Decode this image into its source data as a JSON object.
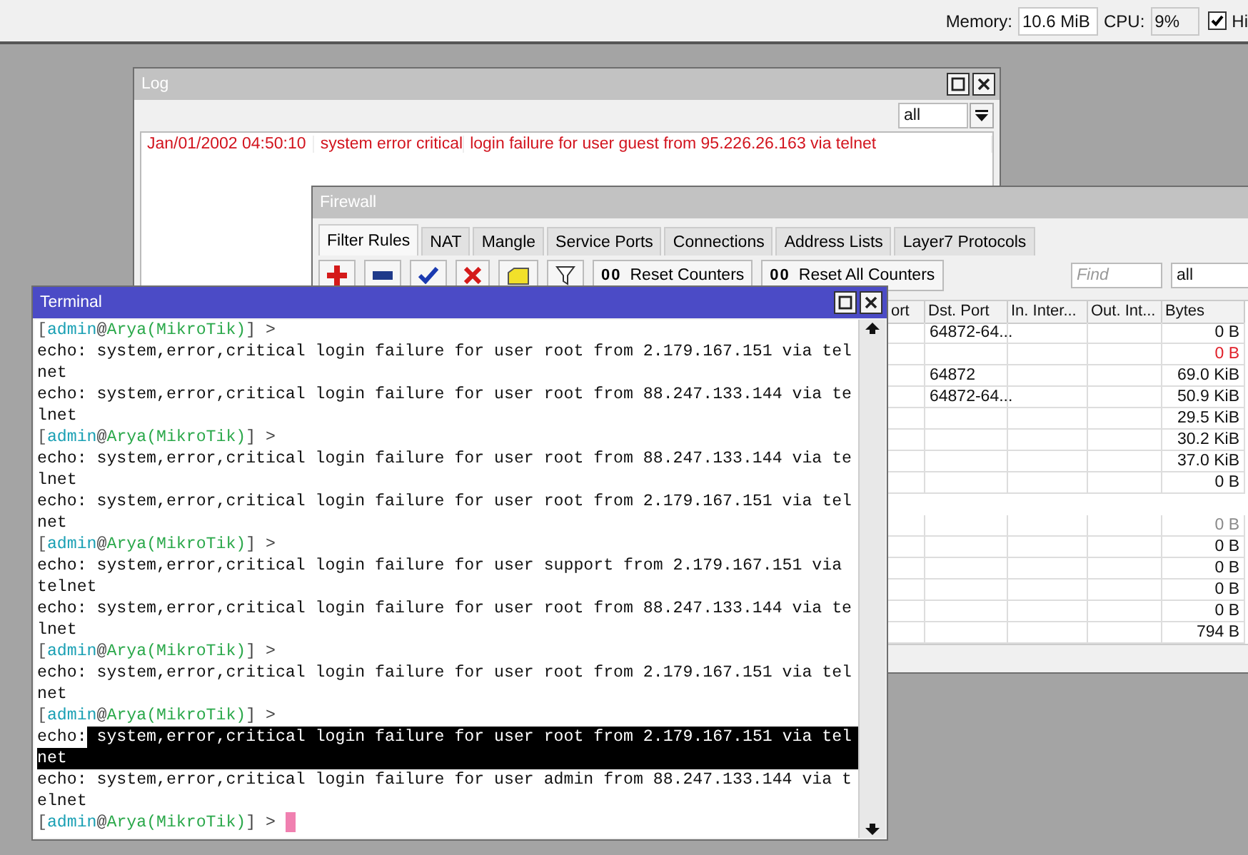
{
  "top_bar": {
    "memory_label": "Memory:",
    "memory_value": "10.6 MiB",
    "cpu_label": "CPU:",
    "cpu_value": "9%",
    "hide_checked": true,
    "hide_label": "Hi"
  },
  "log": {
    "title": "Log",
    "filter": "all",
    "rows": [
      {
        "time": "Jan/01/2002 04:50:10",
        "topics": "system error critical",
        "message": "login failure for user guest from 95.226.26.163 via telnet"
      }
    ]
  },
  "firewall": {
    "title": "Firewall",
    "tabs": [
      {
        "label": "Filter Rules",
        "selected": true
      },
      {
        "label": "NAT",
        "selected": false
      },
      {
        "label": "Mangle",
        "selected": false
      },
      {
        "label": "Service Ports",
        "selected": false
      },
      {
        "label": "Connections",
        "selected": false
      },
      {
        "label": "Address Lists",
        "selected": false
      },
      {
        "label": "Layer7 Protocols",
        "selected": false
      }
    ],
    "toolbar": {
      "reset_icon": "00",
      "reset_counters": "Reset Counters",
      "reset_all_icon": "00",
      "reset_all_counters": "Reset All Counters",
      "find_placeholder": "Find",
      "filter": "all"
    },
    "columns": [
      "ort",
      "Dst. Port",
      "In. Inter...",
      "Out. Int...",
      "Bytes"
    ],
    "rows": [
      {
        "kind": "rule",
        "invalid": false,
        "disabled": false,
        "dst_port": "64872-64...",
        "bytes": "0 B"
      },
      {
        "kind": "rule",
        "invalid": true,
        "disabled": false,
        "bytes": "0 B"
      },
      {
        "kind": "rule",
        "invalid": false,
        "disabled": false,
        "dst_port": "64872",
        "bytes": "69.0 KiB"
      },
      {
        "kind": "rule",
        "invalid": false,
        "disabled": false,
        "dst_port": "64872-64...",
        "bytes": "50.9 KiB"
      },
      {
        "kind": "rule",
        "invalid": false,
        "disabled": false,
        "bytes": "29.5 KiB"
      },
      {
        "kind": "rule",
        "invalid": false,
        "disabled": false,
        "bytes": "30.2 KiB"
      },
      {
        "kind": "rule",
        "invalid": false,
        "disabled": false,
        "bytes": "37.0 KiB"
      },
      {
        "kind": "rule",
        "invalid": false,
        "disabled": false,
        "bytes": "0 B"
      },
      {
        "kind": "separator"
      },
      {
        "kind": "rule",
        "invalid": false,
        "disabled": true,
        "bytes": "0 B"
      },
      {
        "kind": "rule",
        "invalid": false,
        "disabled": false,
        "bytes": "0 B"
      },
      {
        "kind": "rule",
        "invalid": false,
        "disabled": false,
        "bytes": "0 B"
      },
      {
        "kind": "rule",
        "invalid": false,
        "disabled": false,
        "bytes": "0 B"
      },
      {
        "kind": "rule",
        "invalid": false,
        "disabled": false,
        "bytes": "0 B"
      },
      {
        "kind": "rule",
        "invalid": false,
        "disabled": false,
        "bytes": "794 B"
      }
    ]
  },
  "terminal": {
    "title": "Terminal",
    "lines": [
      {
        "kind": "prompt",
        "open": "[",
        "user": "admin",
        "at": "@",
        "host": "Arya(MikroTik)",
        "close": "] >",
        "cursor": false
      },
      {
        "kind": "text",
        "text": "echo: system,error,critical login failure for user root from 2.179.167.151 via tel",
        "selected": false
      },
      {
        "kind": "text",
        "text": "net",
        "selected": false
      },
      {
        "kind": "text",
        "text": "echo: system,error,critical login failure for user root from 88.247.133.144 via te",
        "selected": false
      },
      {
        "kind": "text",
        "text": "lnet",
        "selected": false
      },
      {
        "kind": "prompt",
        "open": "[",
        "user": "admin",
        "at": "@",
        "host": "Arya(MikroTik)",
        "close": "] >",
        "cursor": false
      },
      {
        "kind": "text",
        "text": "echo: system,error,critical login failure for user root from 88.247.133.144 via te",
        "selected": false
      },
      {
        "kind": "text",
        "text": "lnet",
        "selected": false
      },
      {
        "kind": "text",
        "text": "echo: system,error,critical login failure for user root from 2.179.167.151 via tel",
        "selected": false
      },
      {
        "kind": "text",
        "text": "net",
        "selected": false
      },
      {
        "kind": "prompt",
        "open": "[",
        "user": "admin",
        "at": "@",
        "host": "Arya(MikroTik)",
        "close": "] >",
        "cursor": false
      },
      {
        "kind": "text",
        "text": "echo: system,error,critical login failure for user support from 2.179.167.151 via",
        "selected": false
      },
      {
        "kind": "text",
        "text": "telnet",
        "selected": false
      },
      {
        "kind": "text",
        "text": "echo: system,error,critical login failure for user root from 88.247.133.144 via te",
        "selected": false
      },
      {
        "kind": "text",
        "text": "lnet",
        "selected": false
      },
      {
        "kind": "prompt",
        "open": "[",
        "user": "admin",
        "at": "@",
        "host": "Arya(MikroTik)",
        "close": "] >",
        "cursor": false
      },
      {
        "kind": "text",
        "text": "echo: system,error,critical login failure for user root from 2.179.167.151 via tel",
        "selected": false
      },
      {
        "kind": "text",
        "text": "net",
        "selected": false
      },
      {
        "kind": "prompt",
        "open": "[",
        "user": "admin",
        "at": "@",
        "host": "Arya(MikroTik)",
        "close": "] >",
        "cursor": false
      },
      {
        "kind": "text",
        "prefix": "echo:",
        "text": " system,error,critical login failure for user root from 2.179.167.151 via tel",
        "selected": true
      },
      {
        "kind": "text",
        "text": "net",
        "selected": true
      },
      {
        "kind": "text",
        "text": "echo: system,error,critical login failure for user admin from 88.247.133.144 via t",
        "selected": false
      },
      {
        "kind": "text",
        "text": "elnet",
        "selected": false
      },
      {
        "kind": "prompt",
        "open": "[",
        "user": "admin",
        "at": "@",
        "host": "Arya(MikroTik)",
        "close": "] >",
        "cursor": true
      }
    ]
  }
}
